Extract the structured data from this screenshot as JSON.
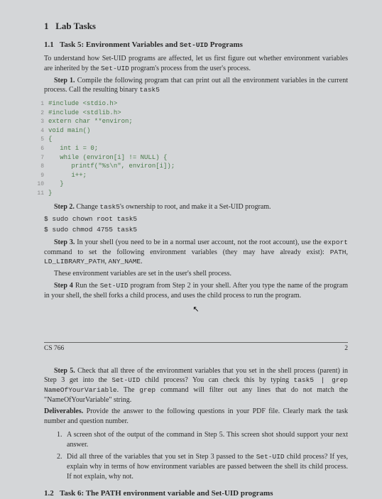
{
  "sec1": {
    "num": "1",
    "title": "Lab Tasks"
  },
  "sec11": {
    "num": "1.1",
    "title": "Task 5: Environment Variables and",
    "title_tt": "Set-UID",
    "title_end": " Programs"
  },
  "intro1": "To understand how Set-UID programs are affected, let us first figure out whether environment variables are inherited by the ",
  "intro1_tt": "Set-UID",
  "intro1_end": " program's process from the user's process.",
  "step1_label": "Step 1.",
  "step1_text": " Compile the following program that can print out all the environment variables in the current process. Call the resulting binary ",
  "step1_tt": "task5",
  "code": {
    "l1": "#include <stdio.h>",
    "l2": "#include <stdlib.h>",
    "l3": "extern char **environ;",
    "l4": "void main()",
    "l5": "{",
    "l6": "   int i = 0;",
    "l7": "   while (environ[i] != NULL) {",
    "l8": "      printf(\"%s\\n\", environ[i]);",
    "l9": "      i++;",
    "l10": "   }",
    "l11": "}"
  },
  "step2_label": "Step 2.",
  "step2_text": " Change ",
  "step2_tt1": "task5",
  "step2_mid": "'s ownership to root, and make it a Set-UID program.",
  "cmd1": "$ sudo chown root task5",
  "cmd2": "$ sudo chmod 4755 task5",
  "step3_label": "Step 3.",
  "step3_text": " In your shell (you need to be in a normal user account, not the root account), use the ",
  "step3_tt1": "export",
  "step3_mid": " command to set the following environment variables (they may have already exist): ",
  "step3_tt2": "PATH",
  "step3_sep": ", ",
  "step3_tt3": "LD_LIBRARY_PATH",
  "step3_sep2": ", ",
  "step3_tt4": "ANY_NAME",
  "step3_end": ".",
  "step3b": "These environment variables are set in the user's shell process.",
  "step4_label": "Step 4",
  "step4_text": " Run the ",
  "step4_tt1": "Set-UID",
  "step4_mid": " program from Step 2 in your shell. After you type the name of the program in your shell, the shell forks a child process, and uses the child process to run the program.",
  "footer_left": "CS 766",
  "footer_right": "2",
  "step5_label": "Step 5.",
  "step5_a": " Check that all three of the environment variables that you set in the shell process (parent) in Step 3 get into the ",
  "step5_tt1": "Set-UID",
  "step5_b": " child process? You can check this by typing ",
  "step5_tt2": "task5 | grep NameOfYourVariable",
  "step5_c": ". The ",
  "step5_tt3": "grep",
  "step5_d": " command will filter out any lines that do not match the \"NameOfYourVariable\" string.",
  "deliv_label": "Deliverables.",
  "deliv_text": " Provide the answer to the following questions in your PDF file. Clearly mark the task number and question number.",
  "q1": "A screen shot of the output of the command in Step 5. This screen shot should support your next answer.",
  "q2a": "Did all three of the variables that you set in Step 3 passed to the ",
  "q2_tt": "Set-UID",
  "q2b": " child process? If yes, explain why in terms of how environment variables are passed between the shell its child process. If not explain, why not.",
  "sec12": {
    "num": "1.2",
    "title": "Task 6: The PATH environment variable and Set-UID programs"
  }
}
